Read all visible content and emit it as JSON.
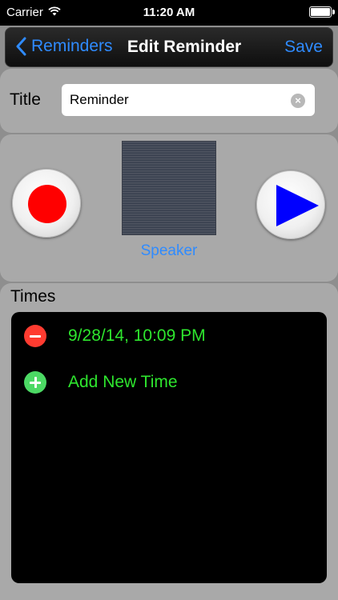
{
  "status_bar": {
    "carrier": "Carrier",
    "time": "11:20 AM",
    "icons": [
      "wifi-icon",
      "battery-icon"
    ]
  },
  "nav": {
    "back_label": "Reminders",
    "title": "Edit Reminder",
    "save_label": "Save",
    "accent_color": "#2f8bff"
  },
  "title_field": {
    "label": "Title",
    "value": "Reminder",
    "clear_icon": "clear-icon"
  },
  "media": {
    "record_icon": "record-icon",
    "play_icon": "play-icon",
    "speaker_label": "Speaker",
    "record_color": "#ff0000",
    "play_color": "#0000ff"
  },
  "times": {
    "label": "Times",
    "items": [
      {
        "text": "9/28/14, 10:09 PM",
        "action": "remove-icon"
      }
    ],
    "add_label": "Add New Time",
    "text_color": "#2ee62e"
  }
}
